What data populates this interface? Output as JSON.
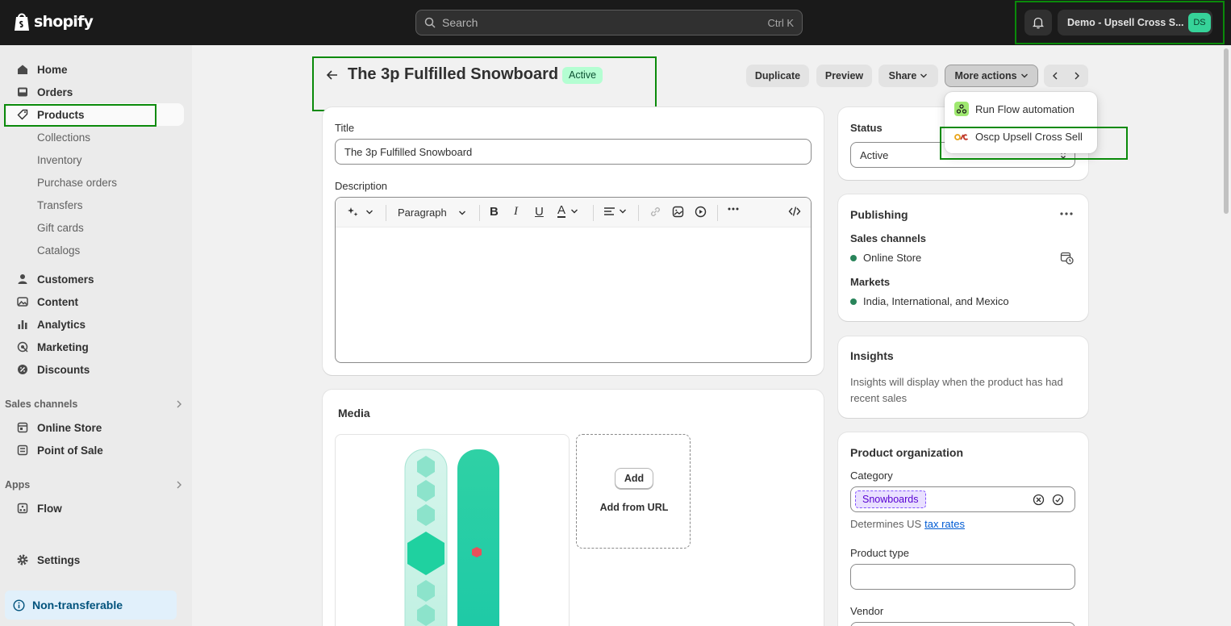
{
  "topbar": {
    "logo_text": "shopify",
    "search_placeholder": "Search",
    "search_shortcut": "Ctrl K",
    "store_name": "Demo - Upsell Cross S...",
    "avatar_initials": "DS"
  },
  "sidebar": {
    "items": [
      {
        "label": "Home",
        "icon": "home-icon"
      },
      {
        "label": "Orders",
        "icon": "orders-icon"
      },
      {
        "label": "Products",
        "icon": "tag-icon"
      },
      {
        "label": "Collections"
      },
      {
        "label": "Inventory"
      },
      {
        "label": "Purchase orders"
      },
      {
        "label": "Transfers"
      },
      {
        "label": "Gift cards"
      },
      {
        "label": "Catalogs"
      },
      {
        "label": "Customers",
        "icon": "person-icon"
      },
      {
        "label": "Content",
        "icon": "image-icon"
      },
      {
        "label": "Analytics",
        "icon": "chart-icon"
      },
      {
        "label": "Marketing",
        "icon": "target-icon"
      },
      {
        "label": "Discounts",
        "icon": "discount-icon"
      }
    ],
    "sales_channels_heading": "Sales channels",
    "channels": [
      {
        "label": "Online Store",
        "icon": "store-icon"
      },
      {
        "label": "Point of Sale",
        "icon": "pos-icon"
      }
    ],
    "apps_heading": "Apps",
    "apps": [
      {
        "label": "Flow",
        "icon": "flow-icon"
      }
    ],
    "settings_label": "Settings",
    "nontransferable_label": "Non-transferable"
  },
  "header": {
    "title": "The 3p Fulfilled Snowboard",
    "status_badge": "Active",
    "duplicate": "Duplicate",
    "preview": "Preview",
    "share": "Share",
    "more_actions": "More actions"
  },
  "more_actions_menu": [
    {
      "label": "Run Flow automation",
      "icon": "flow-app-icon"
    },
    {
      "label": "Oscp Upsell Cross Sell",
      "icon": "oscp-app-icon"
    }
  ],
  "product": {
    "title_label": "Title",
    "title_value": "The 3p Fulfilled Snowboard",
    "description_label": "Description",
    "paragraph_select": "Paragraph"
  },
  "media": {
    "heading": "Media",
    "add_button": "Add",
    "add_from_url": "Add from URL"
  },
  "status_card": {
    "label": "Status",
    "value": "Active"
  },
  "publishing": {
    "heading": "Publishing",
    "sales_channels_label": "Sales channels",
    "channel": "Online Store",
    "markets_label": "Markets",
    "markets_value": "India, International, and Mexico"
  },
  "insights": {
    "heading": "Insights",
    "text": "Insights will display when the product has had recent sales"
  },
  "organization": {
    "heading": "Product organization",
    "category_label": "Category",
    "category_value": "Snowboards",
    "tax_text": "Determines US",
    "tax_link": "tax rates",
    "type_label": "Product type",
    "type_value": "",
    "vendor_label": "Vendor"
  },
  "colors": {
    "topbar": "#1a1a1a",
    "accent_green": "#0a8a0a",
    "active_badge": "#b4fed2",
    "category_chip": "#e9e0ff"
  }
}
